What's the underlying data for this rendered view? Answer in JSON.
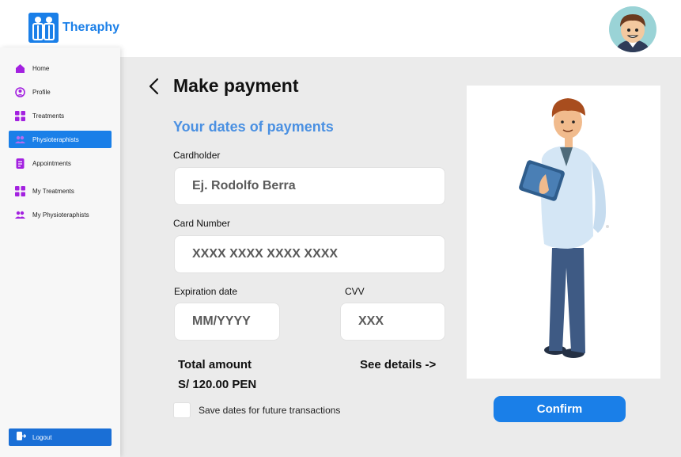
{
  "app": {
    "name": "Theraphy"
  },
  "sidebar": {
    "items": [
      {
        "label": "Home",
        "icon": "home-icon"
      },
      {
        "label": "Profile",
        "icon": "profile-icon"
      },
      {
        "label": "Treatments",
        "icon": "grid-icon"
      },
      {
        "label": "Physioteraphists",
        "icon": "people-icon",
        "active": true
      },
      {
        "label": "Appointments",
        "icon": "document-icon"
      },
      {
        "label": "My Treatments",
        "icon": "grid-icon"
      },
      {
        "label": "My Physioteraphists",
        "icon": "people-icon"
      }
    ],
    "logout_label": "Logout"
  },
  "page": {
    "title": "Make payment",
    "subtitle": "Your  dates of payments"
  },
  "form": {
    "cardholder_label": "Cardholder",
    "cardholder_placeholder": "Ej. Rodolfo Berra",
    "card_number_label": "Card Number",
    "card_number_placeholder": "XXXX XXXX XXXX XXXX",
    "expiration_label": "Expiration date",
    "expiration_placeholder": "MM/YYYY",
    "cvv_label": "CVV",
    "cvv_placeholder": "XXX"
  },
  "summary": {
    "total_label": "Total amount",
    "total_value": "S/ 120.00 PEN",
    "details_link": "See details ->"
  },
  "save_option_label": "Save dates for future transactions",
  "confirm_label": "Confirm",
  "colors": {
    "accent": "#1a7fe8",
    "subtitle": "#4a90e2",
    "nav_icon": "#a321e0",
    "background": "#ebebeb"
  }
}
